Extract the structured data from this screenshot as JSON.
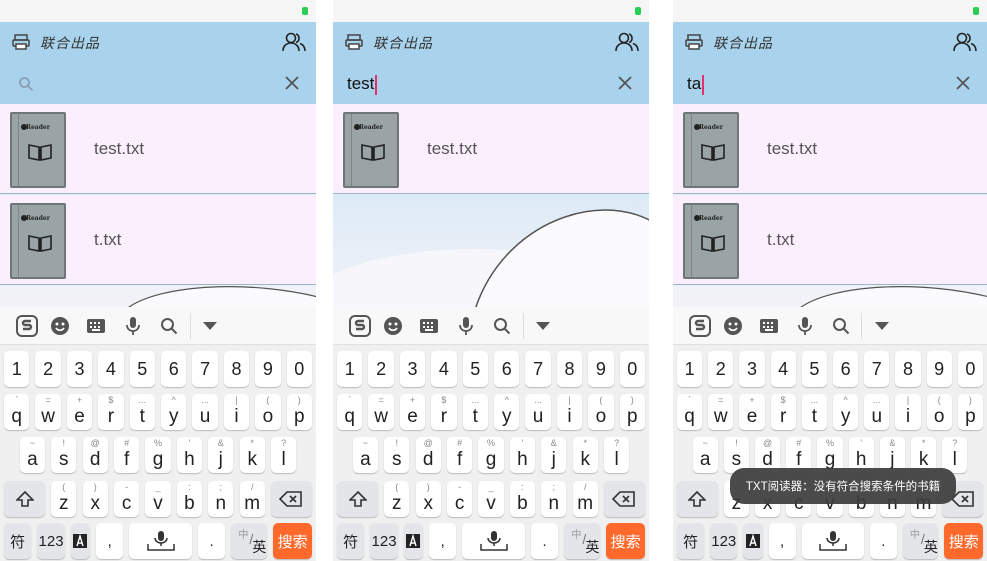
{
  "app_title": "联合出品",
  "search_icon": "search-icon",
  "clear_icon": "close-icon",
  "book_brand": "Reader",
  "colors": {
    "topbar": "#a9d3ec",
    "row_bg": "#fbeefd",
    "search_key": "#ff6a2c",
    "caret": "#e5306d"
  },
  "panels": [
    {
      "query": "",
      "results": [
        {
          "name": "test.txt"
        },
        {
          "name": "t.txt"
        }
      ]
    },
    {
      "query": "test",
      "results": [
        {
          "name": "test.txt"
        }
      ]
    },
    {
      "query": "ta",
      "results": [
        {
          "name": "test.txt"
        },
        {
          "name": "t.txt"
        }
      ]
    }
  ],
  "keyboard": {
    "toolbar_icons": [
      "sogou-logo-icon",
      "emoji-icon",
      "keyboard-icon",
      "microphone-icon",
      "search-icon",
      "collapse-icon"
    ],
    "number_row": [
      "1",
      "2",
      "3",
      "4",
      "5",
      "6",
      "7",
      "8",
      "9",
      "0"
    ],
    "row1": [
      {
        "k": "q",
        "s": "`"
      },
      {
        "k": "w",
        "s": "="
      },
      {
        "k": "e",
        "s": "+"
      },
      {
        "k": "r",
        "s": "$"
      },
      {
        "k": "t",
        "s": "..."
      },
      {
        "k": "y",
        "s": "^"
      },
      {
        "k": "u",
        "s": "..."
      },
      {
        "k": "i",
        "s": "|"
      },
      {
        "k": "o",
        "s": "("
      },
      {
        "k": "p",
        "s": ")"
      }
    ],
    "row2": [
      {
        "k": "a",
        "s": "~"
      },
      {
        "k": "s",
        "s": "!"
      },
      {
        "k": "d",
        "s": "@"
      },
      {
        "k": "f",
        "s": "#"
      },
      {
        "k": "g",
        "s": "%"
      },
      {
        "k": "h",
        "s": "'"
      },
      {
        "k": "j",
        "s": "&"
      },
      {
        "k": "k",
        "s": "*"
      },
      {
        "k": "l",
        "s": "?"
      }
    ],
    "row3": [
      {
        "k": "z",
        "s": "("
      },
      {
        "k": "x",
        "s": ")"
      },
      {
        "k": "c",
        "s": "-"
      },
      {
        "k": "v",
        "s": "_"
      },
      {
        "k": "b",
        "s": ":"
      },
      {
        "k": "n",
        "s": ";"
      },
      {
        "k": "m",
        "s": "/"
      }
    ],
    "symbols": "符",
    "num_switch": "123",
    "comma": ",",
    "period": ".",
    "lang": "中/英",
    "lang_top": "中",
    "lang_bottom": "英",
    "search_label": "搜索"
  },
  "toast": "TXT阅读器：没有符合搜索条件的书籍"
}
